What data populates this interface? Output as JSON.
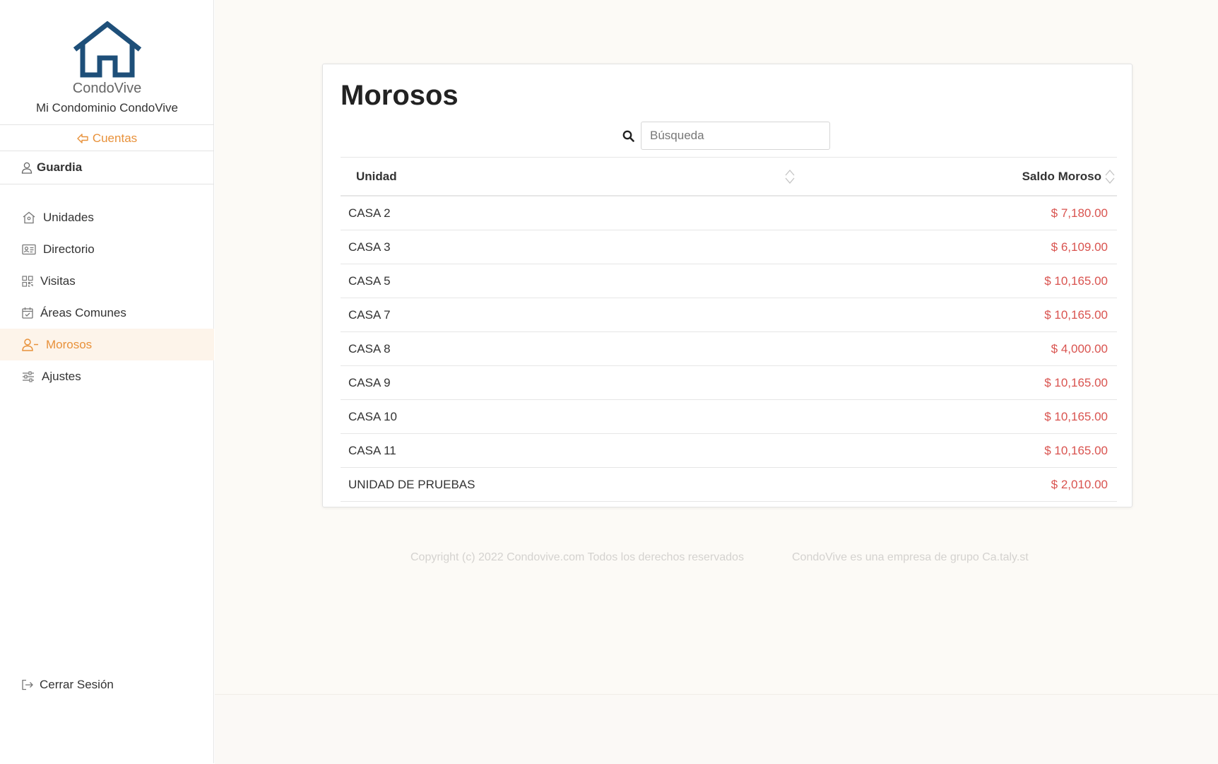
{
  "sidebar": {
    "brand": "CondoVive",
    "condominium": "Mi Condominio CondoVive",
    "accounts_link": "Cuentas",
    "user_name": "Guardia",
    "nav": [
      {
        "label": "Unidades",
        "icon": "home-icon",
        "active": false
      },
      {
        "label": "Directorio",
        "icon": "id-card-icon",
        "active": false
      },
      {
        "label": "Visitas",
        "icon": "qr-code-icon",
        "active": false
      },
      {
        "label": "Áreas Comunes",
        "icon": "calendar-check-icon",
        "active": false
      },
      {
        "label": "Morosos",
        "icon": "user-minus-icon",
        "active": true
      },
      {
        "label": "Ajustes",
        "icon": "sliders-icon",
        "active": false
      }
    ],
    "logout": "Cerrar Sesión"
  },
  "page": {
    "title": "Morosos",
    "search_placeholder": "Búsqueda",
    "search_value": ""
  },
  "table": {
    "columns": [
      "Unidad",
      "Saldo Moroso"
    ],
    "rows": [
      {
        "unidad": "CASA 2",
        "saldo": "$ 7,180.00"
      },
      {
        "unidad": "CASA 3",
        "saldo": "$ 6,109.00"
      },
      {
        "unidad": "CASA 5",
        "saldo": "$ 10,165.00"
      },
      {
        "unidad": "CASA 7",
        "saldo": "$ 10,165.00"
      },
      {
        "unidad": "CASA 8",
        "saldo": "$ 4,000.00"
      },
      {
        "unidad": "CASA 9",
        "saldo": "$ 10,165.00"
      },
      {
        "unidad": "CASA 10",
        "saldo": "$ 10,165.00"
      },
      {
        "unidad": "CASA 11",
        "saldo": "$ 10,165.00"
      },
      {
        "unidad": "UNIDAD DE PRUEBAS",
        "saldo": "$ 2,010.00"
      }
    ]
  },
  "footer": {
    "copyright": "Copyright (c) 2022 Condovive.com Todos los derechos reservados",
    "company": "CondoVive es una empresa de grupo Ca.taly.st"
  },
  "colors": {
    "accent": "#e8913a",
    "logo": "#1e4f79",
    "amount": "#d9534f",
    "active_bg": "#fdf4ea"
  }
}
